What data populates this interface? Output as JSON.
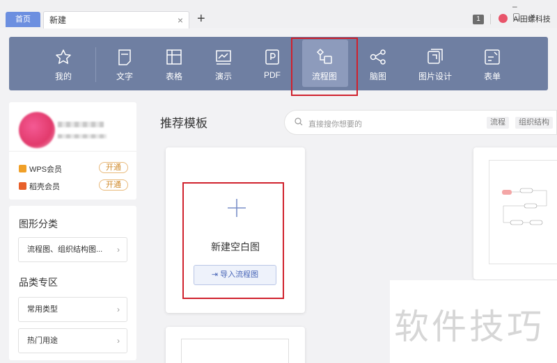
{
  "tabs": {
    "home_label": "首页",
    "new_label": "新建",
    "close_glyph": "×",
    "add_glyph": "+"
  },
  "titlebar": {
    "window_controls": "–▢×",
    "badge": "1",
    "user_name": "Ai田螺科技"
  },
  "toolbar": {
    "items": [
      {
        "label": "我的",
        "icon": "star-icon"
      },
      {
        "label": "文字",
        "icon": "document-icon"
      },
      {
        "label": "表格",
        "icon": "table-icon"
      },
      {
        "label": "演示",
        "icon": "presentation-icon"
      },
      {
        "label": "PDF",
        "icon": "pdf-icon"
      },
      {
        "label": "流程图",
        "icon": "flowchart-icon",
        "active": true
      },
      {
        "label": "脑图",
        "icon": "mindmap-icon"
      },
      {
        "label": "图片设计",
        "icon": "image-design-icon"
      },
      {
        "label": "表单",
        "icon": "form-icon"
      }
    ]
  },
  "sidebar": {
    "membership": [
      {
        "label": "WPS会员",
        "action": "开通",
        "color": "#f0a028"
      },
      {
        "label": "稻壳会员",
        "action": "开通",
        "color": "#e8602a"
      }
    ],
    "section1_title": "图形分类",
    "section1_item": "流程图、组织结构图...",
    "section2_title": "品类专区",
    "section2_items": [
      "常用类型",
      "热门用途"
    ],
    "chevron": "›"
  },
  "main": {
    "title": "推荐模板",
    "search_placeholder": "直接搜你想要的",
    "search_chips": [
      "流程",
      "组织结构"
    ],
    "blank_card_label": "新建空白图",
    "import_button": "导入流程图"
  },
  "watermark": "软件技巧",
  "colors": {
    "toolbar_bg": "#6f7fa2",
    "active_tab_bg": "#6c8fe0",
    "highlight_red": "#d0202c"
  }
}
